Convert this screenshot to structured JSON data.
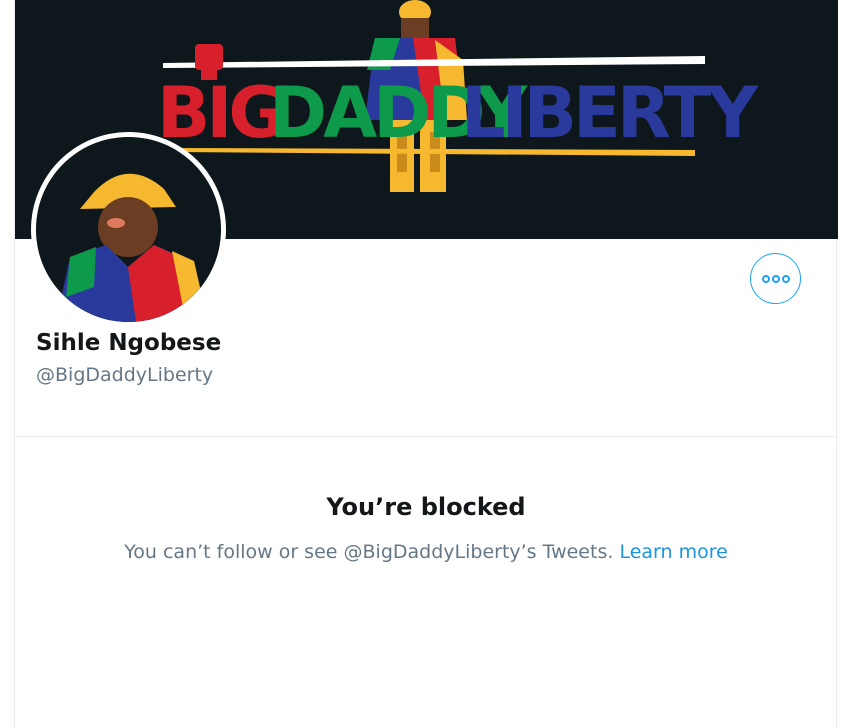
{
  "banner": {
    "words": [
      "BIG",
      "DADDY",
      "LIBERTY"
    ],
    "colors": {
      "background": "#0e171c",
      "big": "#d7202b",
      "daddy": "#0e9a4b",
      "liberty": "#2a3a9c",
      "stripe_white": "#ffffff",
      "stripe_yellow": "#f5b82e"
    }
  },
  "profile": {
    "display_name": "Sihle Ngobese",
    "handle": "@BigDaddyLiberty",
    "more_icon": "more-horizontal-icon"
  },
  "blocked": {
    "title": "You’re blocked",
    "message": "You can’t follow or see @BigDaddyLiberty’s Tweets.",
    "link_label": "Learn more"
  },
  "colors": {
    "accent": "#1da1f2",
    "link": "#1b95e0",
    "text_primary": "#14171a",
    "text_secondary": "#657786",
    "border": "#e6ecf0"
  }
}
